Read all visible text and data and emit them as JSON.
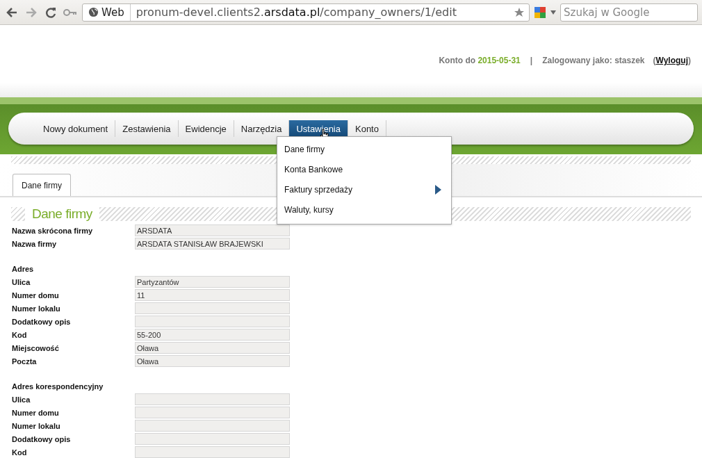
{
  "browser": {
    "site_label": "Web",
    "url": "pronum-devel.clients2.**arsdata.pl**/company_owners/1/edit",
    "search_placeholder": "Szukaj w Google"
  },
  "header": {
    "account_label": "Konto do",
    "account_date": "2015-05-31",
    "separator": "|",
    "logged_as": "Zalogowany jako: staszek",
    "logout_open": "(",
    "logout": "Wyloguj",
    "logout_close": ")"
  },
  "nav": [
    {
      "label": "Nowy dokument",
      "selected": false
    },
    {
      "label": "Zestawienia",
      "selected": false
    },
    {
      "label": "Ewidencje",
      "selected": false
    },
    {
      "label": "Narzędzia",
      "selected": false
    },
    {
      "label": "Ustawienia",
      "selected": true
    },
    {
      "label": "Konto",
      "selected": false
    }
  ],
  "dropdown": [
    {
      "label": "Dane firmy",
      "submenu": false
    },
    {
      "label": "Konta Bankowe",
      "submenu": false
    },
    {
      "label": "Faktury sprzedaży",
      "submenu": true
    },
    {
      "label": "Waluty, kursy",
      "submenu": false
    }
  ],
  "tabs": [
    {
      "label": "Dane firmy",
      "selected": true
    }
  ],
  "section_title": "Dane firmy",
  "form": [
    {
      "kind": "field",
      "label": "Nazwa skrócona firmy",
      "value": "ARSDATA"
    },
    {
      "kind": "field",
      "label": "Nazwa firmy",
      "value": "ARSDATA STANISŁAW BRAJEWSKI"
    },
    {
      "kind": "section",
      "label": "Adres"
    },
    {
      "kind": "field",
      "label": "Ulica",
      "value": "Partyzantów"
    },
    {
      "kind": "field",
      "label": "Numer domu",
      "value": "11"
    },
    {
      "kind": "field",
      "label": "Numer lokalu"
    },
    {
      "kind": "field",
      "label": "Dodatkowy opis"
    },
    {
      "kind": "field",
      "label": "Kod",
      "value": "55-200"
    },
    {
      "kind": "field",
      "label": "Miejscowość",
      "value": "Oława"
    },
    {
      "kind": "field",
      "label": "Poczta",
      "value": "Oława"
    },
    {
      "kind": "section",
      "label": "Adres korespondencyjny"
    },
    {
      "kind": "field",
      "label": "Ulica"
    },
    {
      "kind": "field",
      "label": "Numer domu"
    },
    {
      "kind": "field",
      "label": "Numer lokalu"
    },
    {
      "kind": "field",
      "label": "Dodatkowy opis"
    },
    {
      "kind": "field",
      "label": "Kod"
    }
  ]
}
